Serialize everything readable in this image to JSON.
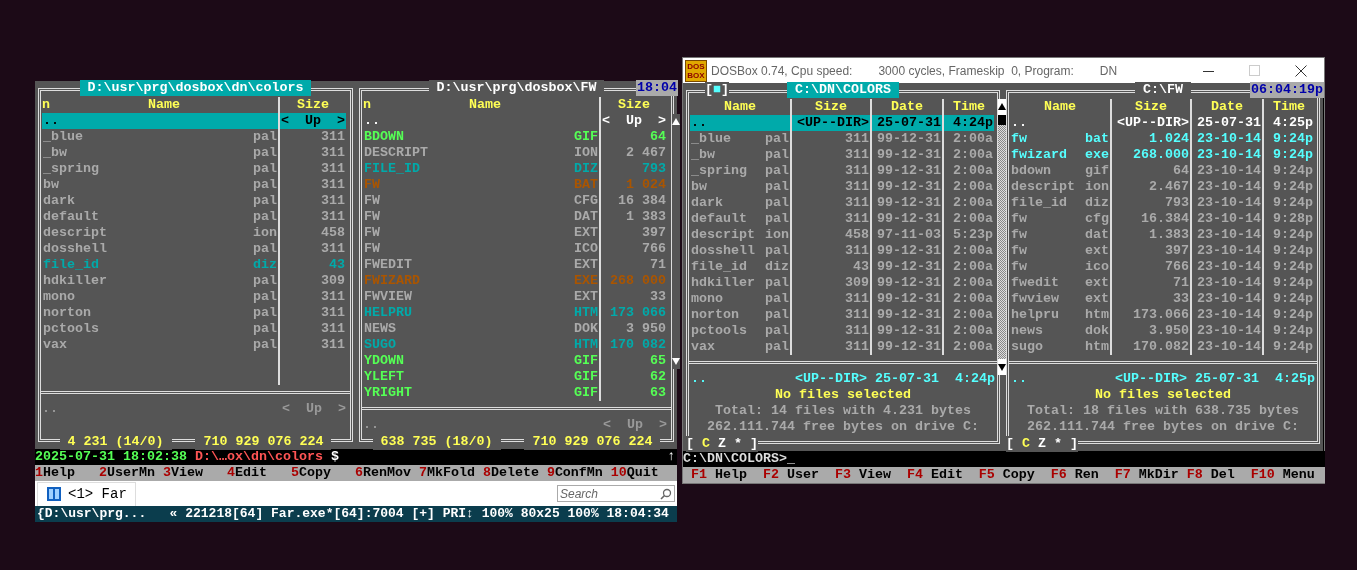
{
  "far_window": {
    "panels": [
      {
        "path": "D:\\usr\\prg\\dosbox\\dn\\colors",
        "selected": true,
        "sort_mark": "n",
        "columns": [
          {
            "kind": "name",
            "label": "Name"
          },
          {
            "kind": "size",
            "label": "Size"
          }
        ],
        "files": [
          {
            "name": "..",
            "size": "<  Up  >",
            "selected": true
          },
          {
            "name": "_blue",
            "ext": "pal",
            "size": "311",
            "selected": false,
            "kind": "file"
          },
          {
            "name": "_bw",
            "ext": "pal",
            "size": "311",
            "selected": false,
            "kind": "file"
          },
          {
            "name": "_spring",
            "ext": "pal",
            "size": "311",
            "selected": false,
            "kind": "file"
          },
          {
            "name": "bw",
            "ext": "pal",
            "size": "311",
            "selected": false,
            "kind": "file"
          },
          {
            "name": "dark",
            "ext": "pal",
            "size": "311",
            "selected": false,
            "kind": "file"
          },
          {
            "name": "default",
            "ext": "pal",
            "size": "311",
            "selected": false,
            "kind": "file"
          },
          {
            "name": "descript",
            "ext": "ion",
            "size": "458",
            "selected": false,
            "kind": "file"
          },
          {
            "name": "dosshell",
            "ext": "pal",
            "size": "311",
            "selected": false,
            "kind": "file"
          },
          {
            "name": "file_id",
            "ext": "diz",
            "size": "43",
            "selected": false,
            "kind": "text"
          },
          {
            "name": "hdkiller",
            "ext": "pal",
            "size": "309",
            "selected": false,
            "kind": "file"
          },
          {
            "name": "mono",
            "ext": "pal",
            "size": "311",
            "selected": false,
            "kind": "file"
          },
          {
            "name": "norton",
            "ext": "pal",
            "size": "311",
            "selected": false,
            "kind": "file"
          },
          {
            "name": "pctools",
            "ext": "pal",
            "size": "311",
            "selected": false,
            "kind": "file"
          },
          {
            "name": "vax",
            "ext": "pal",
            "size": "311",
            "selected": false,
            "kind": "file"
          }
        ],
        "info": {
          "name": "..",
          "size": "<  Up  >"
        },
        "footer": [
          "4 231 (14/0)",
          "710 929 076 224"
        ]
      },
      {
        "path": "D:\\usr\\prg\\dosbox\\FW",
        "selected": false,
        "clock": "18:04",
        "sort_mark": "n",
        "scrollbar": true,
        "columns": [
          {
            "kind": "name",
            "label": "Name"
          },
          {
            "kind": "size",
            "label": "Size"
          }
        ],
        "files": [
          {
            "name": "..",
            "size": "<  Up  >",
            "selected": false,
            "kind": "parent"
          },
          {
            "name": "BDOWN",
            "ext": "GIF",
            "size": "64",
            "selected": false,
            "kind": "image"
          },
          {
            "name": "DESCRIPT",
            "ext": "ION",
            "size": "2 467",
            "selected": false,
            "kind": "file"
          },
          {
            "name": "FILE_ID",
            "ext": "DIZ",
            "size": "793",
            "selected": false,
            "kind": "text"
          },
          {
            "name": "FW",
            "ext": "BAT",
            "size": "1 024",
            "selected": false,
            "kind": "program"
          },
          {
            "name": "FW",
            "ext": "CFG",
            "size": "16 384",
            "selected": false,
            "kind": "file"
          },
          {
            "name": "FW",
            "ext": "DAT",
            "size": "1 383",
            "selected": false,
            "kind": "file"
          },
          {
            "name": "FW",
            "ext": "EXT",
            "size": "397",
            "selected": false,
            "kind": "file"
          },
          {
            "name": "FW",
            "ext": "ICO",
            "size": "766",
            "selected": false,
            "kind": "file"
          },
          {
            "name": "FWEDIT",
            "ext": "EXT",
            "size": "71",
            "selected": false,
            "kind": "file"
          },
          {
            "name": "FWIZARD",
            "ext": "EXE",
            "size": "268 000",
            "selected": false,
            "kind": "program"
          },
          {
            "name": "FWVIEW",
            "ext": "EXT",
            "size": "33",
            "selected": false,
            "kind": "file"
          },
          {
            "name": "HELPRU",
            "ext": "HTM",
            "size": "173 066",
            "selected": false,
            "kind": "text"
          },
          {
            "name": "NEWS",
            "ext": "DOK",
            "size": "3 950",
            "selected": false,
            "kind": "file"
          },
          {
            "name": "SUGO",
            "ext": "HTM",
            "size": "170 082",
            "selected": false,
            "kind": "text"
          },
          {
            "name": "YDOWN",
            "ext": "GIF",
            "size": "65",
            "selected": false,
            "kind": "image"
          },
          {
            "name": "YLEFT",
            "ext": "GIF",
            "size": "62",
            "selected": false,
            "kind": "image"
          },
          {
            "name": "YRIGHT",
            "ext": "GIF",
            "size": "63",
            "selected": false,
            "kind": "image"
          }
        ],
        "info": {
          "name": "..",
          "size": "<  Up  >"
        },
        "footer": [
          "638 735 (18/0)",
          "710 929 076 224"
        ]
      }
    ],
    "command_line": {
      "parts": [
        {
          "text": "2025-07-31 18:02:38",
          "kind": "timestamp"
        },
        {
          "text": "D:\\…ox\\dn\\colors",
          "kind": "path"
        },
        {
          "text": "$",
          "kind": "prompt"
        }
      ],
      "scroll_mark": "↑"
    },
    "keybar": [
      {
        "key": "1",
        "label": "Help"
      },
      {
        "key": "2",
        "label": "UserMn"
      },
      {
        "key": "3",
        "label": "View"
      },
      {
        "key": "4",
        "label": "Edit"
      },
      {
        "key": "5",
        "label": "Copy"
      },
      {
        "key": "6",
        "label": "RenMov"
      },
      {
        "key": "7",
        "label": "MkFold"
      },
      {
        "key": "8",
        "label": "Delete"
      },
      {
        "key": "9",
        "label": "ConfMn"
      },
      {
        "key": "10",
        "label": "Quit"
      }
    ],
    "tabs": [
      {
        "label": "<1> Far",
        "selected": true
      }
    ],
    "search": {
      "placeholder": "Search"
    },
    "status_bar": [
      "{D:\\usr\\prg...",
      "« 221218[64] Far.exe*[64]:7004",
      "[+]",
      "PRI↕",
      "100%",
      "80x25",
      "100%",
      "18:04:34"
    ]
  },
  "dosbox_window": {
    "logo": [
      "DOS",
      "BOX"
    ],
    "title": [
      "DOSBox 0.74, Cpu speed:",
      "3000 cycles, Frameskip  0, Program:",
      "DN"
    ],
    "screen": {
      "panels": [
        {
          "path": "C:\\DN\\COLORS",
          "selected": true,
          "close_mark": "[■]",
          "scrollbar": true,
          "columns": [
            {
              "kind": "name",
              "label": "Name"
            },
            {
              "kind": "size",
              "label": "Size"
            },
            {
              "kind": "date",
              "label": "Date"
            },
            {
              "kind": "time",
              "label": "Time"
            }
          ],
          "files": [
            {
              "name": "..",
              "size": "<UP--DIR>",
              "date": "25-07-31",
              "time": "4:24p",
              "selected": true
            },
            {
              "name": "_blue",
              "ext": "pal",
              "size": "311",
              "date": "99-12-31",
              "time": "2:00a",
              "selected": false,
              "kind": "file"
            },
            {
              "name": "_bw",
              "ext": "pal",
              "size": "311",
              "date": "99-12-31",
              "time": "2:00a",
              "selected": false,
              "kind": "file"
            },
            {
              "name": "_spring",
              "ext": "pal",
              "size": "311",
              "date": "99-12-31",
              "time": "2:00a",
              "selected": false,
              "kind": "file"
            },
            {
              "name": "bw",
              "ext": "pal",
              "size": "311",
              "date": "99-12-31",
              "time": "2:00a",
              "selected": false,
              "kind": "file"
            },
            {
              "name": "dark",
              "ext": "pal",
              "size": "311",
              "date": "99-12-31",
              "time": "2:00a",
              "selected": false,
              "kind": "file"
            },
            {
              "name": "default",
              "ext": "pal",
              "size": "311",
              "date": "99-12-31",
              "time": "2:00a",
              "selected": false,
              "kind": "file"
            },
            {
              "name": "descript",
              "ext": "ion",
              "size": "458",
              "date": "97-11-03",
              "time": "5:23p",
              "selected": false,
              "kind": "file"
            },
            {
              "name": "dosshell",
              "ext": "pal",
              "size": "311",
              "date": "99-12-31",
              "time": "2:00a",
              "selected": false,
              "kind": "file"
            },
            {
              "name": "file_id",
              "ext": "diz",
              "size": "43",
              "date": "99-12-31",
              "time": "2:00a",
              "selected": false,
              "kind": "file"
            },
            {
              "name": "hdkiller",
              "ext": "pal",
              "size": "309",
              "date": "99-12-31",
              "time": "2:00a",
              "selected": false,
              "kind": "file"
            },
            {
              "name": "mono",
              "ext": "pal",
              "size": "311",
              "date": "99-12-31",
              "time": "2:00a",
              "selected": false,
              "kind": "file"
            },
            {
              "name": "norton",
              "ext": "pal",
              "size": "311",
              "date": "99-12-31",
              "time": "2:00a",
              "selected": false,
              "kind": "file"
            },
            {
              "name": "pctools",
              "ext": "pal",
              "size": "311",
              "date": "99-12-31",
              "time": "2:00a",
              "selected": false,
              "kind": "file"
            },
            {
              "name": "vax",
              "ext": "pal",
              "size": "311",
              "date": "99-12-31",
              "time": "2:00a",
              "selected": false,
              "kind": "file"
            }
          ],
          "info": {
            "name": "..",
            "size": "<UP--DIR>",
            "date": "25-07-31",
            "time": "4:24p"
          },
          "summary": [
            "No files selected",
            "Total: **14** files with **4.231** bytes",
            "**262.111.744** free bytes on drive **C:**"
          ],
          "drive_bar": {
            "open": "[",
            "close": "]",
            "drives": [
              {
                "label": "C",
                "selected": true
              },
              {
                "label": "Z",
                "selected": false
              },
              {
                "label": "*",
                "selected": false
              }
            ]
          }
        },
        {
          "path": "C:\\FW",
          "selected": false,
          "clock": "06:04:19p",
          "columns": [
            {
              "kind": "name",
              "label": "Name"
            },
            {
              "kind": "size",
              "label": "Size"
            },
            {
              "kind": "date",
              "label": "Date"
            },
            {
              "kind": "time",
              "label": "Time"
            }
          ],
          "files": [
            {
              "name": "..",
              "size": "<UP--DIR>",
              "date": "25-07-31",
              "time": "4:25p",
              "selected": false,
              "kind": "parent"
            },
            {
              "name": "fw",
              "ext": "bat",
              "size": "1.024",
              "date": "23-10-14",
              "time": "9:24p",
              "selected": false,
              "kind": "program"
            },
            {
              "name": "fwizard",
              "ext": "exe",
              "size": "268.000",
              "date": "23-10-14",
              "time": "9:24p",
              "selected": false,
              "kind": "program"
            },
            {
              "name": "bdown",
              "ext": "gif",
              "size": "64",
              "date": "23-10-14",
              "time": "9:24p",
              "selected": false,
              "kind": "file"
            },
            {
              "name": "descript",
              "ext": "ion",
              "size": "2.467",
              "date": "23-10-14",
              "time": "9:24p",
              "selected": false,
              "kind": "file"
            },
            {
              "name": "file_id",
              "ext": "diz",
              "size": "793",
              "date": "23-10-14",
              "time": "9:24p",
              "selected": false,
              "kind": "file"
            },
            {
              "name": "fw",
              "ext": "cfg",
              "size": "16.384",
              "date": "23-10-14",
              "time": "9:28p",
              "selected": false,
              "kind": "file"
            },
            {
              "name": "fw",
              "ext": "dat",
              "size": "1.383",
              "date": "23-10-14",
              "time": "9:24p",
              "selected": false,
              "kind": "file"
            },
            {
              "name": "fw",
              "ext": "ext",
              "size": "397",
              "date": "23-10-14",
              "time": "9:24p",
              "selected": false,
              "kind": "file"
            },
            {
              "name": "fw",
              "ext": "ico",
              "size": "766",
              "date": "23-10-14",
              "time": "9:24p",
              "selected": false,
              "kind": "file"
            },
            {
              "name": "fwedit",
              "ext": "ext",
              "size": "71",
              "date": "23-10-14",
              "time": "9:24p",
              "selected": false,
              "kind": "file"
            },
            {
              "name": "fwview",
              "ext": "ext",
              "size": "33",
              "date": "23-10-14",
              "time": "9:24p",
              "selected": false,
              "kind": "file"
            },
            {
              "name": "helpru",
              "ext": "htm",
              "size": "173.066",
              "date": "23-10-14",
              "time": "9:24p",
              "selected": false,
              "kind": "file"
            },
            {
              "name": "news",
              "ext": "dok",
              "size": "3.950",
              "date": "23-10-14",
              "time": "9:24p",
              "selected": false,
              "kind": "file"
            },
            {
              "name": "sugo",
              "ext": "htm",
              "size": "170.082",
              "date": "23-10-14",
              "time": "9:24p",
              "selected": false,
              "kind": "file"
            }
          ],
          "info": {
            "name": "..",
            "size": "<UP--DIR>",
            "date": "25-07-31",
            "time": "4:25p"
          },
          "summary": [
            "No files selected",
            "Total: **18** files with **638.735** bytes",
            "**262.111.744** free bytes on drive **C:**"
          ],
          "drive_bar": {
            "open": "[",
            "close": "]",
            "drives": [
              {
                "label": "C",
                "selected": true
              },
              {
                "label": "Z",
                "selected": false
              },
              {
                "label": "*",
                "selected": false
              }
            ]
          }
        }
      ],
      "command_line": {
        "prompt": "C:\\DN\\COLORS>",
        "cursor": "_"
      },
      "keybar": [
        {
          "key": "F1",
          "label": "Help"
        },
        {
          "key": "F2",
          "label": "User"
        },
        {
          "key": "F3",
          "label": "View"
        },
        {
          "key": "F4",
          "label": "Edit"
        },
        {
          "key": "F5",
          "label": "Copy"
        },
        {
          "key": "F6",
          "label": "Ren"
        },
        {
          "key": "F7",
          "label": "MkDir"
        },
        {
          "key": "F8",
          "label": "Del"
        },
        {
          "key": "F10",
          "label": "Menu"
        }
      ]
    }
  }
}
